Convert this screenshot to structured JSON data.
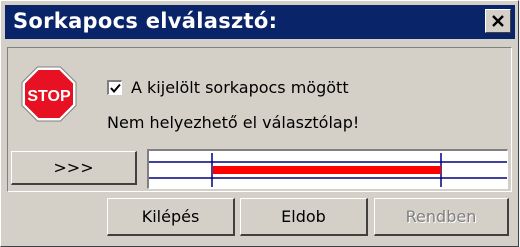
{
  "dialog": {
    "title": "Sorkapocs elválasztó:",
    "checkbox": {
      "label": "A kijelölt sorkapocs mögött",
      "checked": true
    },
    "message": "Nem helyezhető el választólap!",
    "stop_icon_text": "STOP",
    "more_button": ">>>",
    "buttons": {
      "exit": "Kilépés",
      "drop": "Eldob",
      "ok": "Rendben"
    }
  },
  "colors": {
    "titlebar": "#0a246a",
    "stop_red": "#e81123",
    "preview_bar": "#ff0000",
    "preview_lines": "#000080"
  }
}
